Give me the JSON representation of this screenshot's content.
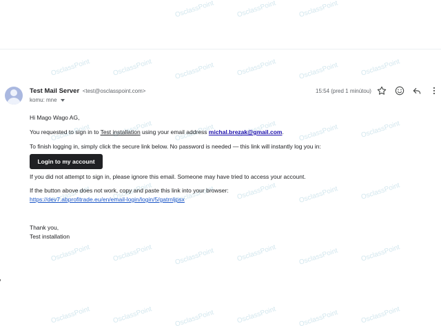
{
  "watermark": "OsclassPoint",
  "email": {
    "sender_name": "Test Mail Server",
    "sender_email": "<test@osclasspoint.com>",
    "to_label": "komu: mne",
    "time": "15:54 (pred 1 minútou)",
    "greeting": "Hi Mago Wago AG,",
    "line1_pre": "You requested to sign in to ",
    "line1_site": "Test installation",
    "line1_mid": " using your email address ",
    "line1_email": "michal.brezak@gmail.com",
    "line1_post": ".",
    "line2": "To finish logging in, simply click the secure link below. No password is needed — this link will instantly log you in:",
    "button_label": "Login to my account",
    "line3": "If you did not attempt to sign in, please ignore this email. Someone may have tried to access your account.",
    "line4": "If the button above does not work, copy and paste this link into your browser:",
    "link": "https://dev7.abprofitrade.eu/en/email-login/login/5/gatrnljpsx",
    "closing1": "Thank you,",
    "closing2": "Test installation"
  },
  "icons": {
    "star": "star-icon",
    "emoji": "emoji-icon",
    "reply": "reply-icon",
    "more": "more-vert-icon",
    "avatar": "avatar-icon"
  }
}
